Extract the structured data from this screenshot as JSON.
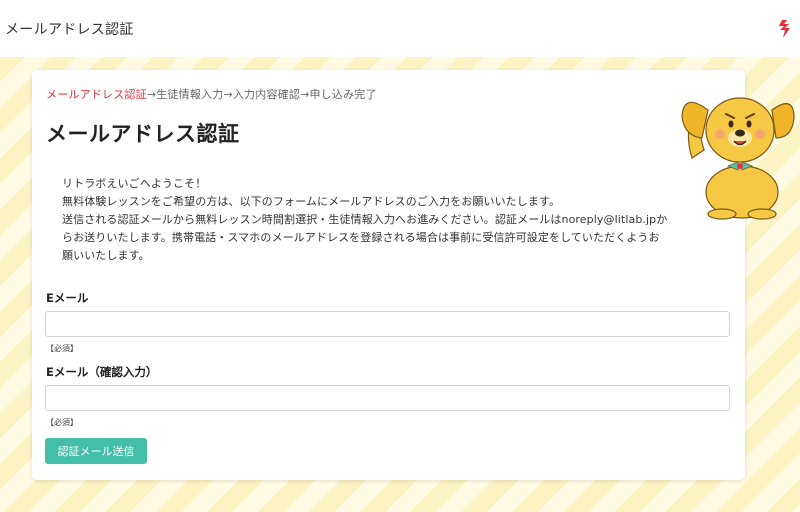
{
  "header": {
    "title": "メールアドレス認証",
    "logo_icon": "red-flame-logo-icon"
  },
  "breadcrumb": {
    "steps": [
      "メールアドレス認証",
      "生徒情報入力",
      "入力内容確認",
      "申し込み完了"
    ],
    "separator": "→"
  },
  "page": {
    "heading": "メールアドレス認証",
    "intro": [
      "リトラボえいごへようこそ！",
      "無料体験レッスンをご希望の方は、以下のフォームにメールアドレスのご入力をお願いいたします。",
      "送信される認証メールから無料レッスン時間割選択・生徒情報入力へお進みください。認証メールはnoreply@litlab.jpか",
      "らお送りいたします。携帯電話・スマホのメールアドレスを登録される場合は事前に受信許可設定をしていただくようお",
      "願いいたします。"
    ]
  },
  "form": {
    "email_label": "Eメール",
    "email_value": "",
    "email_required": "【必須】",
    "confirm_label": "Eメール（確認入力）",
    "confirm_value": "",
    "confirm_required": "【必須】",
    "submit_label": "認証メール送信"
  },
  "colors": {
    "accent_red": "#e5313a",
    "button_teal": "#43bfa7",
    "stripe_yellow": "#fbf3c4"
  },
  "mascot_icon": "yellow-dog-mascot-icon"
}
